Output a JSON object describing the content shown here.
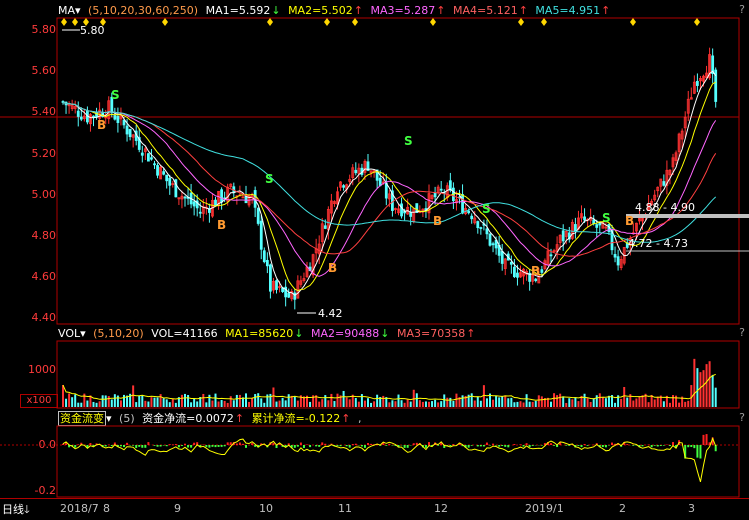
{
  "price_header": {
    "name": "MA",
    "periods": "(5,10,20,30,60,250)",
    "ma1": "MA1=5.592",
    "ma2": "MA2=5.502",
    "ma3": "MA3=5.287",
    "ma4": "MA4=5.121",
    "ma5": "MA5=4.951",
    "help": "?"
  },
  "price_axis": [
    "5.80",
    "5.60",
    "5.40",
    "5.20",
    "5.00",
    "4.80",
    "4.60",
    "4.40"
  ],
  "price_annotations": {
    "high": "5.80",
    "low": "4.42",
    "range1": "4.88 - 4.90",
    "range2": "4.72 - 4.73"
  },
  "signals": {
    "buy": "B",
    "sell": "S"
  },
  "vol_header": {
    "name": "VOL",
    "periods": "(5,10,20)",
    "vol": "VOL=41166",
    "ma1": "MA1=85620",
    "ma2": "MA2=90488",
    "ma3": "MA3=70358",
    "help": "?"
  },
  "vol_axis": {
    "mark": "1000",
    "unit": "x100"
  },
  "flow_header": {
    "name": "资金流变",
    "periods": "(5)",
    "net": "资金净流=0.0072",
    "cum": "累计净流=-0.122",
    "tail": ",",
    "help": "?"
  },
  "flow_axis": [
    "0.0",
    "-0.2"
  ],
  "footer": {
    "period": "日线",
    "months": [
      "2018/7",
      "8",
      "9",
      "10",
      "11",
      "12",
      "2019/1",
      "2",
      "3"
    ]
  },
  "colors": {
    "up": "#ff3232",
    "down": "#54ffff",
    "ma1": "#ffffff",
    "ma2": "#ffff00",
    "ma3": "#ff66ff",
    "ma4": "#ff4040",
    "ma5": "#40e0e0",
    "flow_pos": "#ff2020",
    "flow_neg": "#40ff40"
  }
}
